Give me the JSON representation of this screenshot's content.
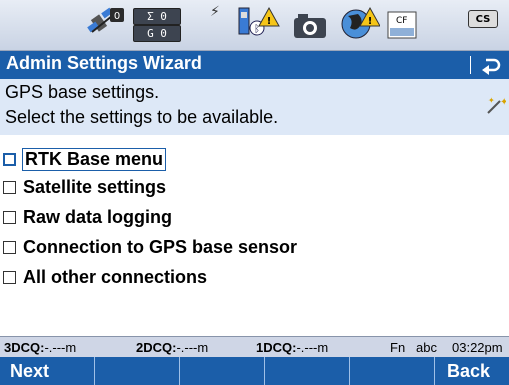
{
  "status": {
    "sat_count_top": "0",
    "sigma_top": "Σ 0",
    "g_count": "G 0",
    "cf_label": "CF",
    "cs_label": "CS",
    "icons": [
      "satellite-icon",
      "bolt-icon",
      "instrument-bluetooth-warning-icon",
      "camera-icon",
      "globe-warning-icon",
      "cf-card-icon",
      "cs-icon"
    ]
  },
  "title": {
    "text": "Admin Settings Wizard"
  },
  "info": {
    "line1": "GPS base settings.",
    "line2": "Select the settings to be available."
  },
  "options": [
    {
      "label": "RTK Base menu",
      "checked": false
    },
    {
      "label": "Satellite settings",
      "checked": false
    },
    {
      "label": "Raw data logging",
      "checked": false
    },
    {
      "label": "Connection to GPS base sensor",
      "checked": false
    },
    {
      "label": "All other connections",
      "checked": false
    }
  ],
  "quality": {
    "q3_label": "3DCQ:",
    "q3_value": "-.---m",
    "q2_label": "2DCQ:",
    "q2_value": "-.---m",
    "q1_label": "1DCQ:",
    "q1_value": "-.---m",
    "fn": "Fn",
    "mode": "abc",
    "time": "03:22pm"
  },
  "softkeys": {
    "left": "Next",
    "right": "Back"
  }
}
